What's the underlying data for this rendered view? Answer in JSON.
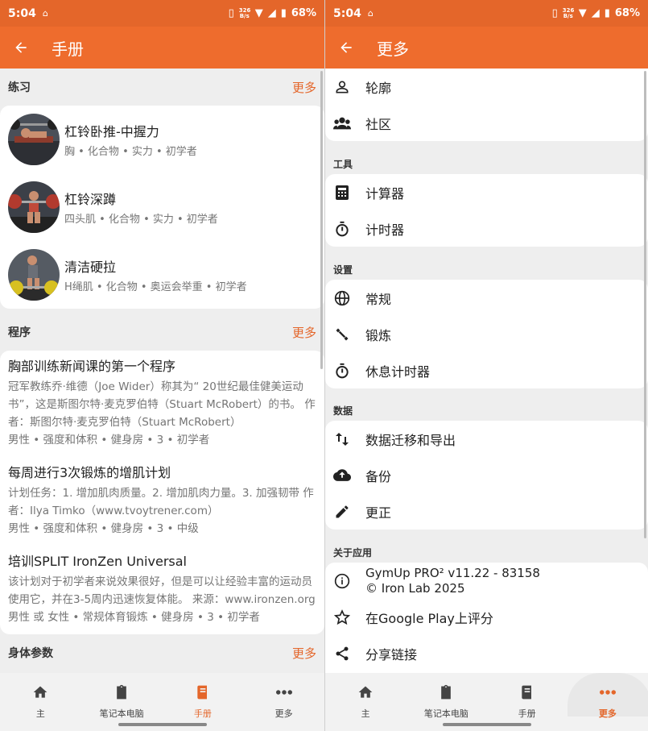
{
  "status": {
    "time": "5:04",
    "speed_top": "326",
    "speed_bottom": "B/s",
    "battery": "68%"
  },
  "left": {
    "title": "手册",
    "exercises": {
      "heading": "练习",
      "more": "更多",
      "items": [
        {
          "title": "杠铃卧推-中握力",
          "sub": "胸 • 化合物 • 实力 • 初学者"
        },
        {
          "title": "杠铃深蹲",
          "sub": "四头肌 • 化合物 • 实力 • 初学者"
        },
        {
          "title": "清洁硬拉",
          "sub": "H绳肌 • 化合物 • 奥运会举重 • 初学者"
        }
      ]
    },
    "programs": {
      "heading": "程序",
      "more": "更多",
      "items": [
        {
          "title": "胸部训练新闻课的第一个程序",
          "desc": "冠军教练乔·维德（Joe Wider）称其为“ 20世纪最佳健美运动书”，这是斯图尔特·麦克罗伯特（Stuart McRobert）的书。 作者：斯图尔特·麦克罗伯特（Stuart McRobert）",
          "meta": "男性 • 强度和体积 • 健身房 • 3 • 初学者"
        },
        {
          "title": "每周进行3次锻炼的增肌计划",
          "desc": "计划任务：1. 增加肌肉质量。2. 增加肌肉力量。3. 加强韧带 作者：Ilya Timko（www.tvoytrener.com）",
          "meta": "男性 • 强度和体积 • 健身房 • 3 • 中级"
        },
        {
          "title": "培训SPLIT IronZen Universal",
          "desc": "该计划对于初学者来说效果很好，但是可以让经验丰富的运动员使用它，并在3-5周内迅速恢复体能。 来源：www.ironzen.org",
          "meta": "男性 或 女性 • 常规体育锻炼 • 健身房 • 3 • 初学者"
        }
      ]
    },
    "body": {
      "heading": "身体参数",
      "more": "更多"
    }
  },
  "right": {
    "title": "更多",
    "group1": {
      "items": [
        {
          "label": "轮廓",
          "icon": "person-icon"
        },
        {
          "label": "社区",
          "icon": "people-icon"
        }
      ]
    },
    "tools": {
      "heading": "工具",
      "items": [
        {
          "label": "计算器",
          "icon": "calculator-icon"
        },
        {
          "label": "计时器",
          "icon": "timer-icon"
        }
      ]
    },
    "settings": {
      "heading": "设置",
      "items": [
        {
          "label": "常规",
          "icon": "globe-icon"
        },
        {
          "label": "锻炼",
          "icon": "dumbbell-icon"
        },
        {
          "label": "休息计时器",
          "icon": "timer-icon"
        }
      ]
    },
    "data": {
      "heading": "数据",
      "items": [
        {
          "label": "数据迁移和导出",
          "icon": "swap-vertical-icon"
        },
        {
          "label": "备份",
          "icon": "cloud-upload-icon"
        },
        {
          "label": "更正",
          "icon": "pencil-icon"
        }
      ]
    },
    "about": {
      "heading": "关于应用",
      "version": "GymUp PRO² v11.22 - 83158",
      "copyright": "© Iron Lab 2025",
      "rate": "在Google Play上评分",
      "share": "分享链接"
    }
  },
  "nav": {
    "home": "主",
    "notebook": "笔记本电脑",
    "manual": "手册",
    "more": "更多"
  },
  "colors": {
    "accent": "#ee6c2d",
    "status": "#e4662a",
    "background": "#eeeeee"
  }
}
